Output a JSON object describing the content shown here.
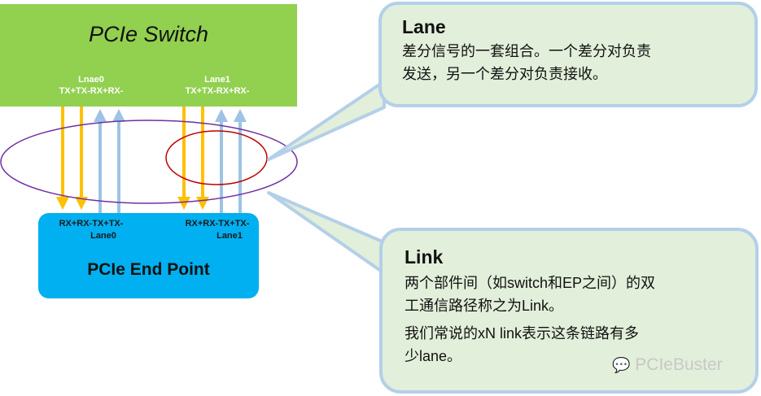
{
  "switch": {
    "title": "PCIe Switch",
    "lanes": [
      {
        "name": "Lnae0",
        "pins": "TX+TX-RX+RX-"
      },
      {
        "name": "Lane1",
        "pins": "TX+TX-RX+RX-"
      }
    ]
  },
  "endpoint": {
    "title": "PCIe End Point",
    "lanes": [
      {
        "name": "Lane0",
        "pins": "RX+RX-TX+TX-"
      },
      {
        "name": "Lane1",
        "pins": "RX+RX-TX+TX-"
      }
    ]
  },
  "lane_callout": {
    "title": "Lane",
    "lines": [
      "差分信号的一套组合。一个差分对负责",
      "发送，另一个差分对负责接收。"
    ]
  },
  "link_callout": {
    "title": "Link",
    "lines": [
      "两个部件间（如switch和EP之间）的双",
      "工通信路径称之为Link。",
      "我们常说的xN link表示这条链路有多",
      "少lane。"
    ]
  },
  "watermark": "PCIeBuster",
  "colors": {
    "switch": "#92d050",
    "endpoint": "#00b0f0",
    "tx": "#ffc000",
    "rx": "#9dc3e6",
    "link_ring": "#7030a0",
    "lane_ring": "#c00000",
    "callout_fill": "#e2efda",
    "callout_border": "#b4cfe9"
  }
}
